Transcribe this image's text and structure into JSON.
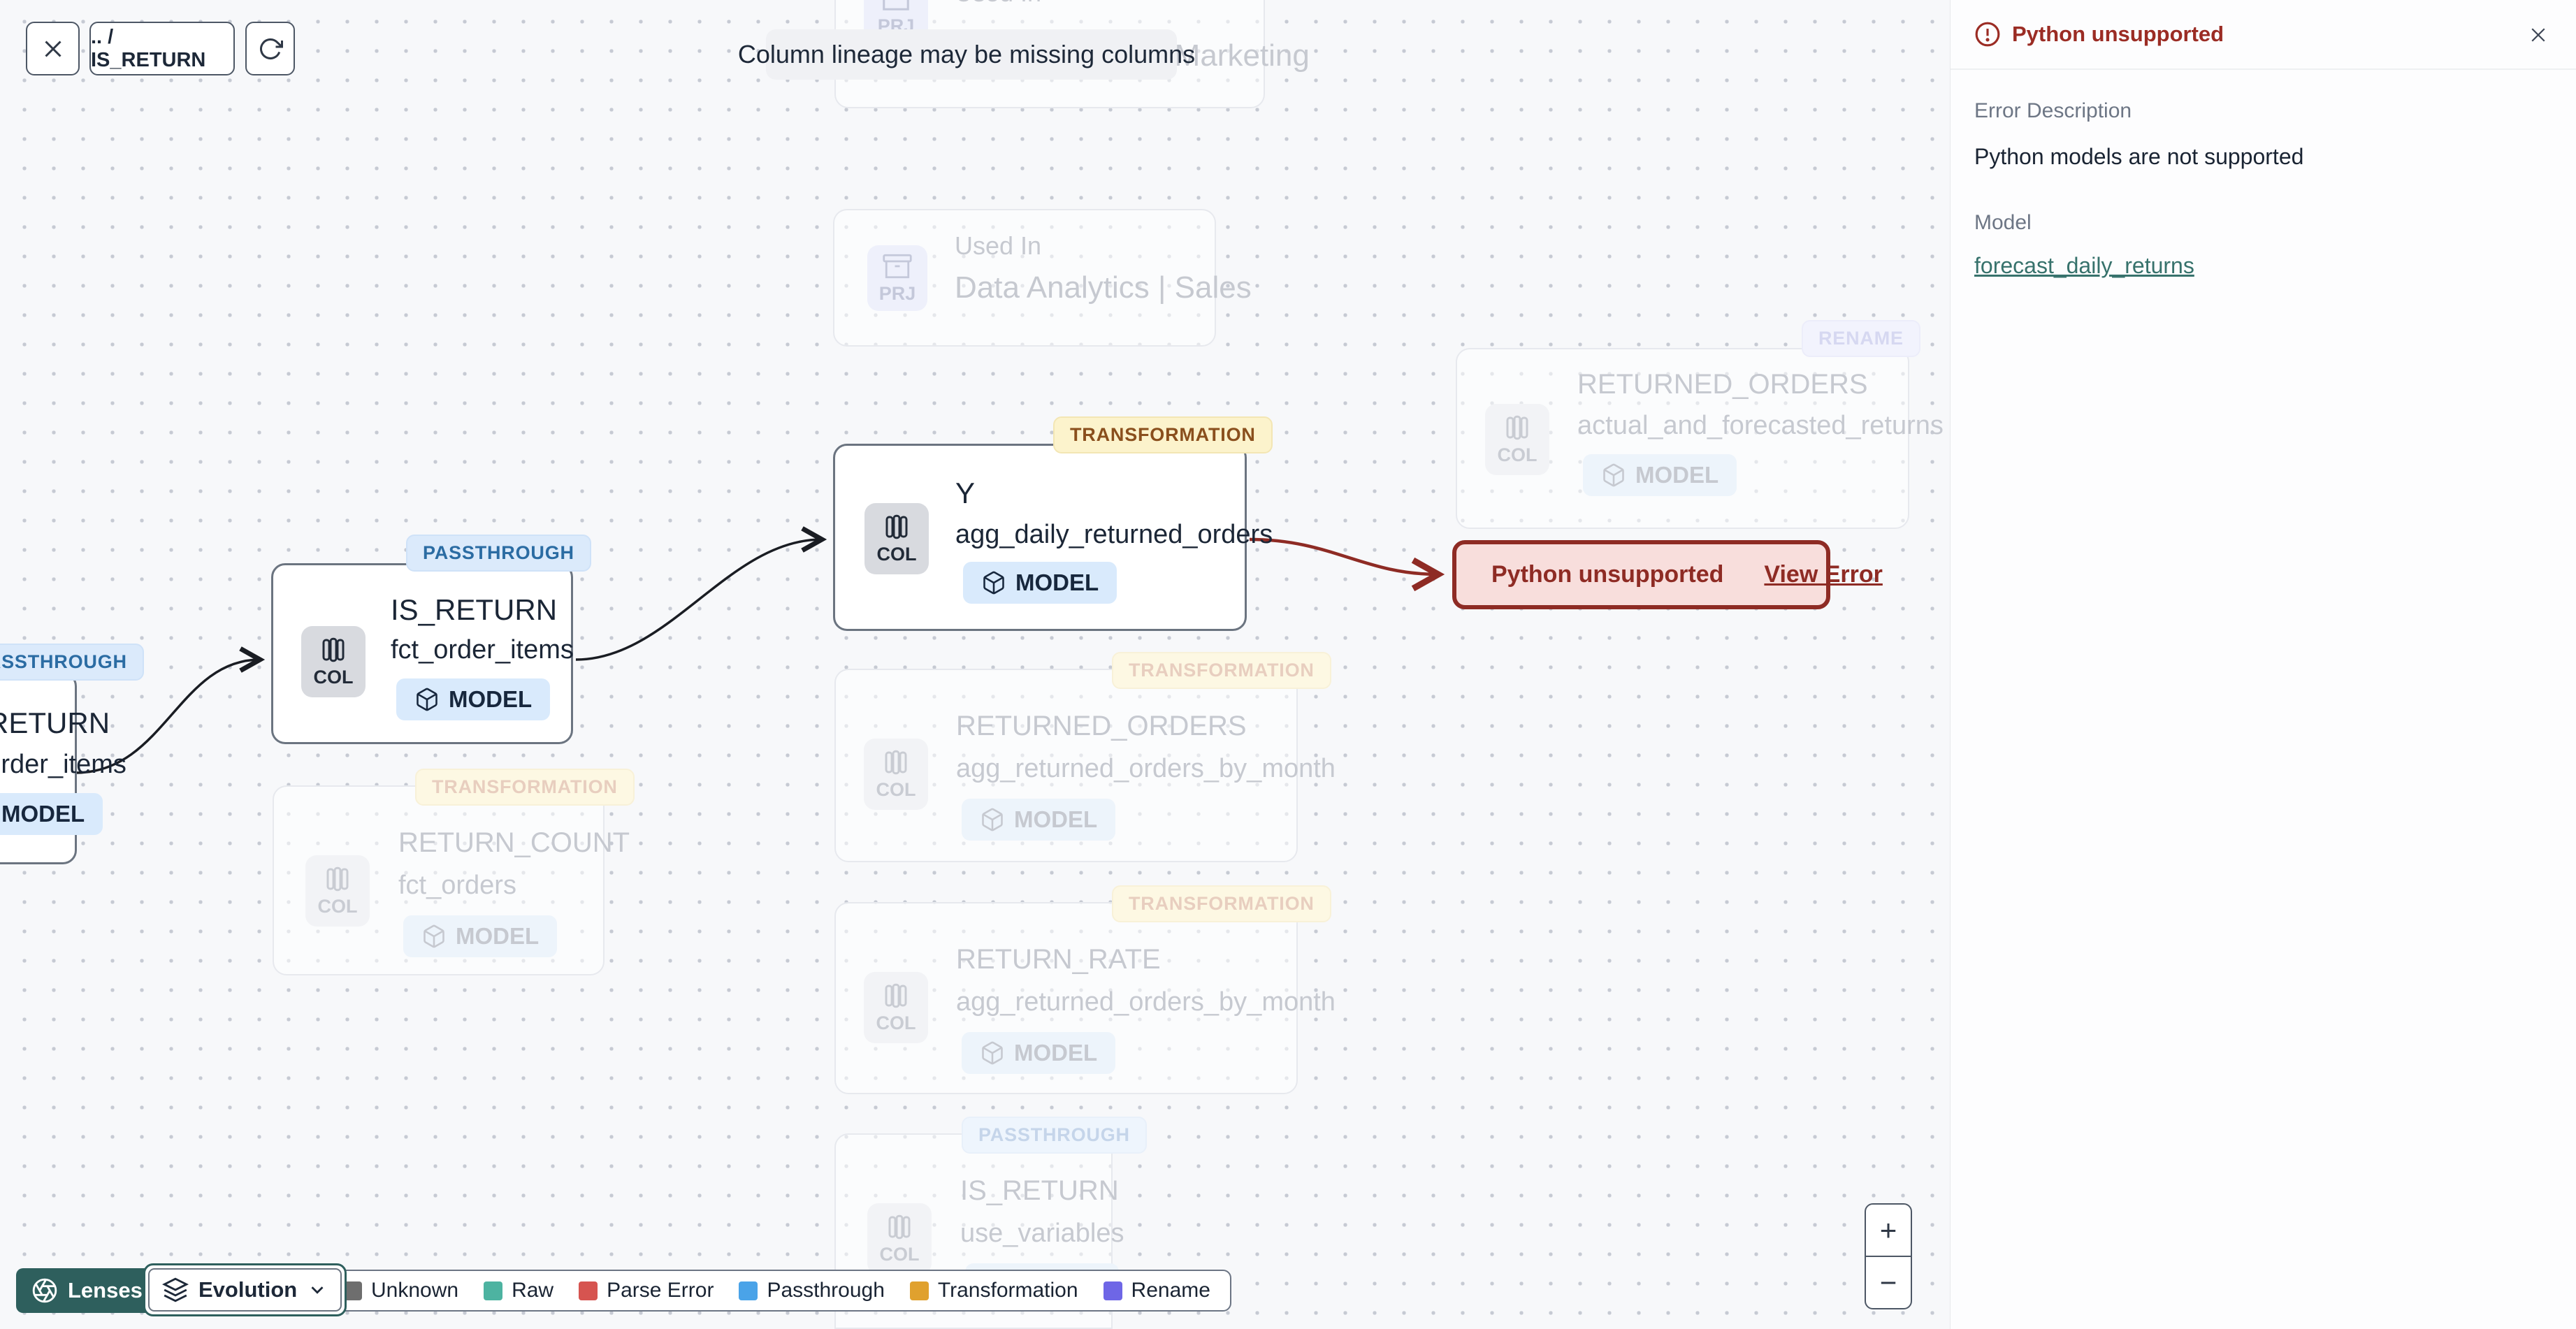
{
  "topbar": {
    "breadcrumb": ".. / IS_RETURN"
  },
  "banner": {
    "text": "Column lineage may be missing columns"
  },
  "panel": {
    "title": "Python unsupported",
    "error_description_label": "Error Description",
    "error_description": "Python models are not supported",
    "model_label": "Model",
    "model_link": "forecast_daily_returns"
  },
  "error_node": {
    "label": "Python unsupported",
    "action": "View Error"
  },
  "nodes": [
    {
      "badge": "",
      "icon_label": "PRJ",
      "title": "Used In",
      "subtitle": "Data Analytics | Marketing",
      "chip": ""
    },
    {
      "badge": "",
      "icon_label": "PRJ",
      "title": "Used In",
      "subtitle": "Data Analytics | Sales",
      "chip": ""
    },
    {
      "badge": "PASSTHROUGH",
      "icon_label": "COL",
      "title": "IS_RETURN",
      "subtitle": "fct_order_items",
      "chip": "MODEL"
    },
    {
      "badge": "PASSTHROUGH",
      "icon_label": "COL",
      "title": "IS_RETURN",
      "subtitle": "fct_order_items",
      "chip": "MODEL"
    },
    {
      "badge": "TRANSFORMATION",
      "icon_label": "COL",
      "title": "Y",
      "subtitle": "agg_daily_returned_orders",
      "chip": "MODEL"
    },
    {
      "badge": "RENAME",
      "icon_label": "COL",
      "title": "RETURNED_ORDERS",
      "subtitle": "actual_and_forecasted_returns",
      "chip": "MODEL"
    },
    {
      "badge": "TRANSFORMATION",
      "icon_label": "COL",
      "title": "RETURNED_ORDERS",
      "subtitle": "agg_returned_orders_by_month",
      "chip": "MODEL"
    },
    {
      "badge": "TRANSFORMATION",
      "icon_label": "COL",
      "title": "RETURN_COUNT",
      "subtitle": "fct_orders",
      "chip": "MODEL"
    },
    {
      "badge": "TRANSFORMATION",
      "icon_label": "COL",
      "title": "RETURN_RATE",
      "subtitle": "agg_returned_orders_by_month",
      "chip": "MODEL"
    },
    {
      "badge": "PASSTHROUGH",
      "icon_label": "COL",
      "title": "IS_RETURN",
      "subtitle": "use_variables",
      "chip": "MODEL"
    }
  ],
  "toolbar": {
    "lenses_label": "Lenses",
    "evolution_label": "Evolution"
  },
  "legend": {
    "items": [
      {
        "label": "Unknown",
        "color": "#6e6e6e",
        "swatch_style": "background:#6e6e6e"
      },
      {
        "label": "Raw",
        "color": "#4db3a1",
        "swatch_style": "background:#4db3a1"
      },
      {
        "label": "Parse Error",
        "color": "#d65450",
        "swatch_style": "background:#d65450"
      },
      {
        "label": "Passthrough",
        "color": "#4aa3e8",
        "swatch_style": "background:#4aa3e8"
      },
      {
        "label": "Transformation",
        "color": "#e0a12e",
        "swatch_style": "background:#e0a12e"
      },
      {
        "label": "Rename",
        "color": "#6e66e6",
        "swatch_style": "background:#6e66e6"
      }
    ]
  },
  "zoom": {
    "in": "+",
    "out": "−"
  },
  "colors": {
    "accent_teal": "#2e5f5d",
    "error_red": "#8e2b24",
    "error_bg": "#f8dedc",
    "link_teal": "#37726c",
    "badge_passthrough_bg": "#dbeafb",
    "badge_transformation_bg": "#fcf3cc",
    "badge_rename_bg": "#eceefb",
    "model_chip_bg": "#d9eafc"
  }
}
